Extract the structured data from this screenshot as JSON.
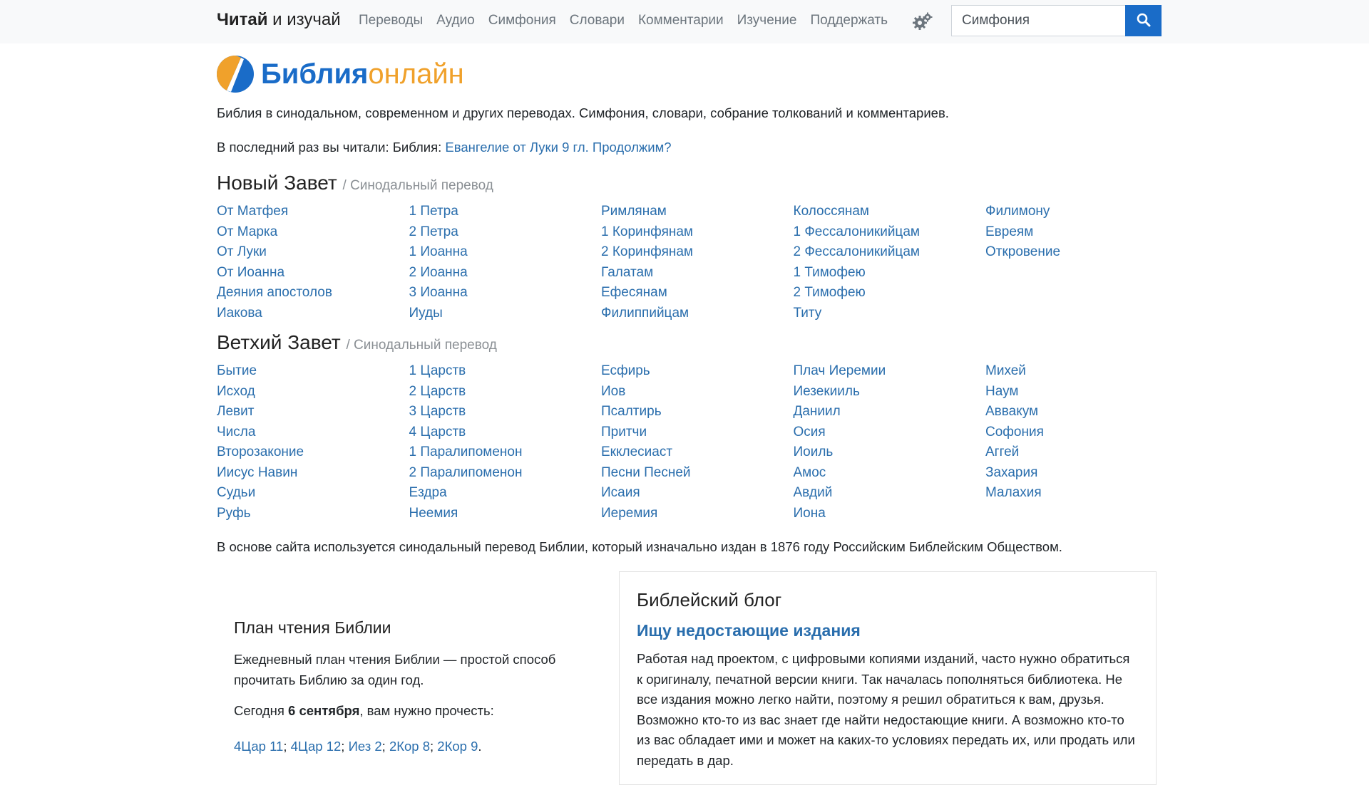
{
  "navbar": {
    "brand_bold": "Читай",
    "brand_rest": " и изучай",
    "items": [
      "Переводы",
      "Аудио",
      "Симфония",
      "Словари",
      "Комментарии",
      "Изучение",
      "Поддержать"
    ],
    "search_value": "Симфония",
    "icons": {
      "settings": "gears-icon",
      "search": "search-icon"
    }
  },
  "logo": {
    "word1": "Библия",
    "word2": "онлайн"
  },
  "intro": "Библия в синодальном, современном и других переводах. Симфония, словари, собрание толкований и комментариев.",
  "last_read": {
    "prefix": "В последний раз вы читали: Библия:",
    "link": "Евангелие от Луки 9 гл. Продолжим?"
  },
  "new_testament": {
    "title": "Новый Завет",
    "subtitle": "/ Синодальный перевод",
    "books": [
      "От Матфея",
      "От Марка",
      "От Луки",
      "От Иоанна",
      "Деяния апостолов",
      "Иакова",
      "1 Петра",
      "2 Петра",
      "1 Иоанна",
      "2 Иоанна",
      "3 Иоанна",
      "Иуды",
      "Римлянам",
      "1 Коринфянам",
      "2 Коринфянам",
      "Галатам",
      "Ефесянам",
      "Филиппийцам",
      "Колоссянам",
      "1 Фессалоникийцам",
      "2 Фессалоникийцам",
      "1 Тимофею",
      "2 Тимофею",
      "Титу",
      "Филимону",
      "Евреям",
      "Откровение"
    ]
  },
  "old_testament": {
    "title": "Ветхий Завет",
    "subtitle": "/ Синодальный перевод",
    "books": [
      "Бытие",
      "Исход",
      "Левит",
      "Числа",
      "Второзаконие",
      "Иисус Навин",
      "Судьи",
      "Руфь",
      "1 Царств",
      "2 Царств",
      "3 Царств",
      "4 Царств",
      "1 Паралипоменон",
      "2 Паралипоменон",
      "Ездра",
      "Неемия",
      "Есфирь",
      "Иов",
      "Псалтирь",
      "Притчи",
      "Екклесиаст",
      "Песни Песней",
      "Исаия",
      "Иеремия",
      "Плач Иеремии",
      "Иезекииль",
      "Даниил",
      "Осия",
      "Иоиль",
      "Амос",
      "Авдий",
      "Иона",
      "Михей",
      "Наум",
      "Аввакум",
      "Софония",
      "Аггей",
      "Захария",
      "Малахия"
    ]
  },
  "footnote": "В основе сайта используется синодальный перевод Библии, который изначально издан в 1876 году Российским Библейским Обществом.",
  "plan": {
    "title": "План чтения Библии",
    "desc": "Ежедневный план чтения Библии — простой способ прочитать Библию за один год.",
    "today_prefix": "Сегодня ",
    "today_date": "6 сентября",
    "today_suffix": ", вам нужно прочесть:",
    "readings": [
      "4Цар 11",
      "4Цар 12",
      "Иез 2",
      "2Кор 8",
      "2Кор 9"
    ]
  },
  "blog": {
    "title": "Библейский блог",
    "post_title": "Ищу недостающие издания",
    "post_text": "Работая над проектом, с цифровыми копиями изданий, часто нужно обратиться к оригиналу, печатной версии книги. Так началась пополняться библиотека. Не все издания можно легко найти, поэтому я решил обратиться к вам, друзья. Возможно кто-то из вас знает где найти недостающие книги. А возможно кто-то из вас обладает ими и может на каких-то условиях передать их, или продать или передать в дар."
  },
  "colors": {
    "link": "#2a6ead",
    "brand_blue": "#1a6cc8",
    "brand_orange": "#f0a12b"
  }
}
